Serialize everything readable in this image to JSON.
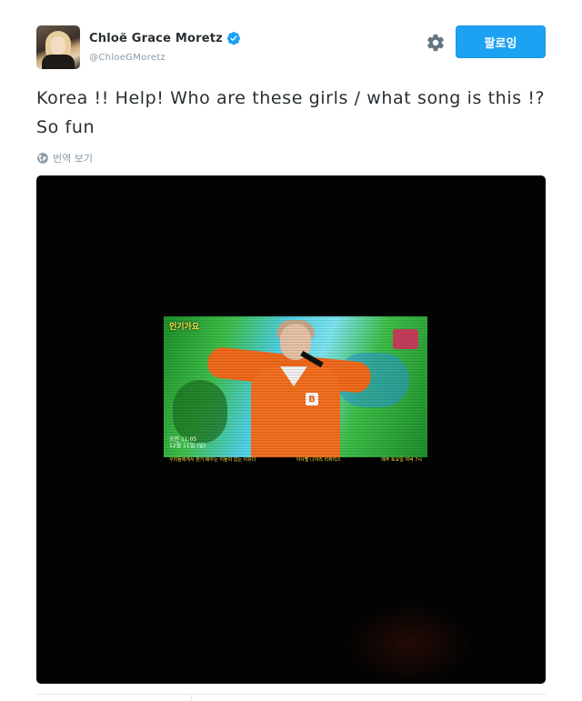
{
  "user": {
    "display_name": "Chloë Grace Moretz",
    "handle": "@ChloeGMoretz",
    "verified": true,
    "avatar_icon": "profile-photo"
  },
  "actions": {
    "follow_label": "팔로잉",
    "settings_icon": "gear-icon"
  },
  "tweet": {
    "text": "Korea !! Help! Who are these girls / what song is this !? So fun",
    "translate_label": "번역 보기",
    "translate_icon": "globe-icon"
  },
  "media": {
    "type": "video-still",
    "tv_logo_left": "인기가요",
    "tv_time": "오전 11:05",
    "tv_time_sub": "12월 11일 (일)",
    "ticker_left": "우리들에게서 뭔가 배우는 이들이 있는 이유다",
    "ticker_mid": "이사벨 나이리 리뷰리스",
    "ticker_right": "매주 토요일 저녁 7시"
  },
  "colors": {
    "accent": "#1da1f2",
    "text": "#292f33",
    "muted": "#8899a6",
    "verified": "#1da1f2"
  }
}
